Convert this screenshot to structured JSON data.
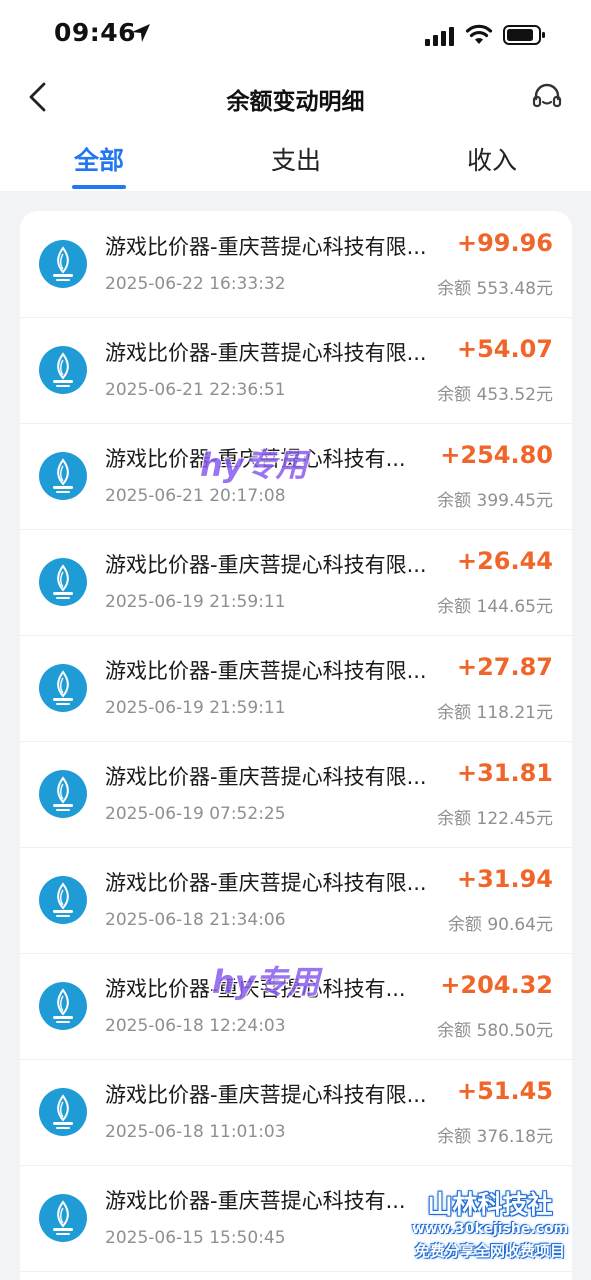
{
  "status_bar": {
    "time": "09:46",
    "icons": [
      "location-arrow-icon",
      "cellular-signal-icon",
      "wifi-icon",
      "battery-icon"
    ]
  },
  "header": {
    "title": "余额变动明细",
    "back_icon": "chevron-left-icon",
    "support_icon": "headset-icon"
  },
  "tabs": [
    {
      "label": "全部",
      "active": true
    },
    {
      "label": "支出",
      "active": false
    },
    {
      "label": "收入",
      "active": false
    }
  ],
  "colors": {
    "accent": "#2377f0",
    "amount": "#f06529",
    "muted_text": "#8f8f8f",
    "background": "#f2f3f7"
  },
  "transactions": [
    {
      "title": "游戏比价器-重庆菩提心科技有限...",
      "time": "2025-06-22 16:33:32",
      "amount": "+99.96",
      "balance": "余额 553.48元"
    },
    {
      "title": "游戏比价器-重庆菩提心科技有限...",
      "time": "2025-06-21 22:36:51",
      "amount": "+54.07",
      "balance": "余额 453.52元"
    },
    {
      "title": "游戏比价器-重庆菩提心科技有...",
      "time": "2025-06-21 20:17:08",
      "amount": "+254.80",
      "balance": "余额 399.45元"
    },
    {
      "title": "游戏比价器-重庆菩提心科技有限...",
      "time": "2025-06-19 21:59:11",
      "amount": "+26.44",
      "balance": "余额 144.65元"
    },
    {
      "title": "游戏比价器-重庆菩提心科技有限...",
      "time": "2025-06-19 21:59:11",
      "amount": "+27.87",
      "balance": "余额 118.21元"
    },
    {
      "title": "游戏比价器-重庆菩提心科技有限...",
      "time": "2025-06-19 07:52:25",
      "amount": "+31.81",
      "balance": "余额 122.45元"
    },
    {
      "title": "游戏比价器-重庆菩提心科技有限...",
      "time": "2025-06-18 21:34:06",
      "amount": "+31.94",
      "balance": "余额 90.64元"
    },
    {
      "title": "游戏比价器-重庆菩提心科技有...",
      "time": "2025-06-18 12:24:03",
      "amount": "+204.32",
      "balance": "余额 580.50元"
    },
    {
      "title": "游戏比价器-重庆菩提心科技有限...",
      "time": "2025-06-18 11:01:03",
      "amount": "+51.45",
      "balance": "余额 376.18元"
    },
    {
      "title": "游戏比价器-重庆菩提心科技有...",
      "time": "2025-06-15 15:50:45",
      "amount": "",
      "balance": ""
    }
  ],
  "watermarks": {
    "overlay_1": "hy专用",
    "overlay_2": "hy专用",
    "brand_name": "山林科技社",
    "brand_url": "www.30kejishe.com",
    "brand_tagline": "免费分享全网收费项目"
  }
}
